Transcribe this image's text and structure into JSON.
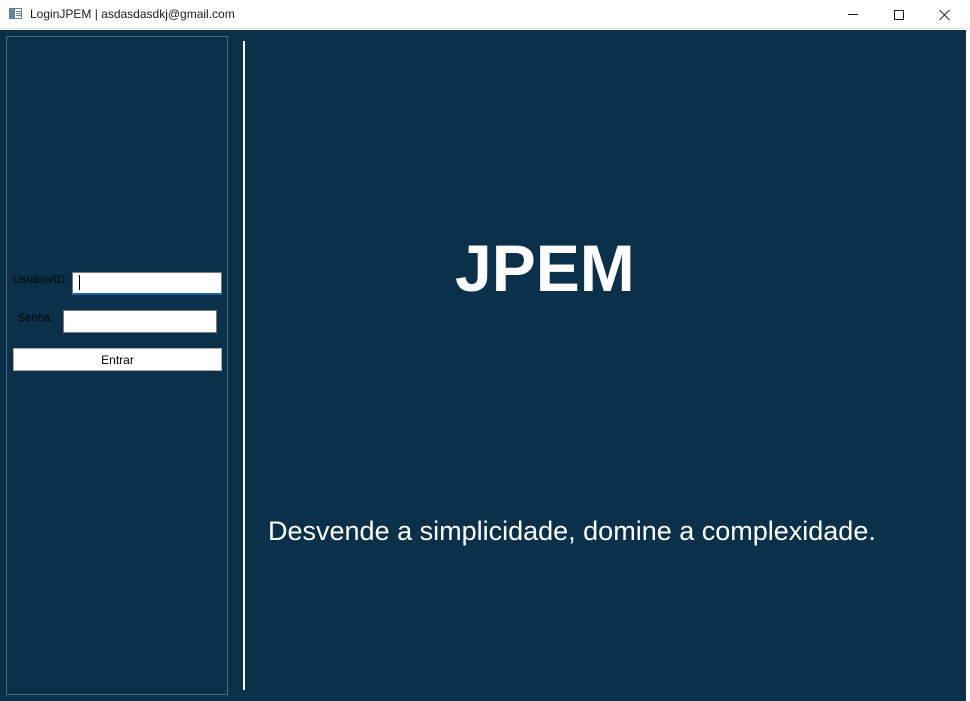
{
  "window": {
    "title": "LoginJPEM | asdasdasdkj@gmail.com",
    "controls": {
      "minimize_icon": "minimize-icon",
      "maximize_icon": "maximize-icon",
      "close_icon": "close-icon"
    }
  },
  "login": {
    "user_label": "Usuário/ID:",
    "user_value": "",
    "password_label": "Senha:",
    "password_value": "",
    "submit_label": "Entrar"
  },
  "brand": {
    "name": "JPEM",
    "tagline": "Desvende a simplicidade, domine a complexidade."
  },
  "colors": {
    "background": "#0a3149",
    "text": "#ffffff",
    "focus_accent": "#1b5fa8"
  }
}
